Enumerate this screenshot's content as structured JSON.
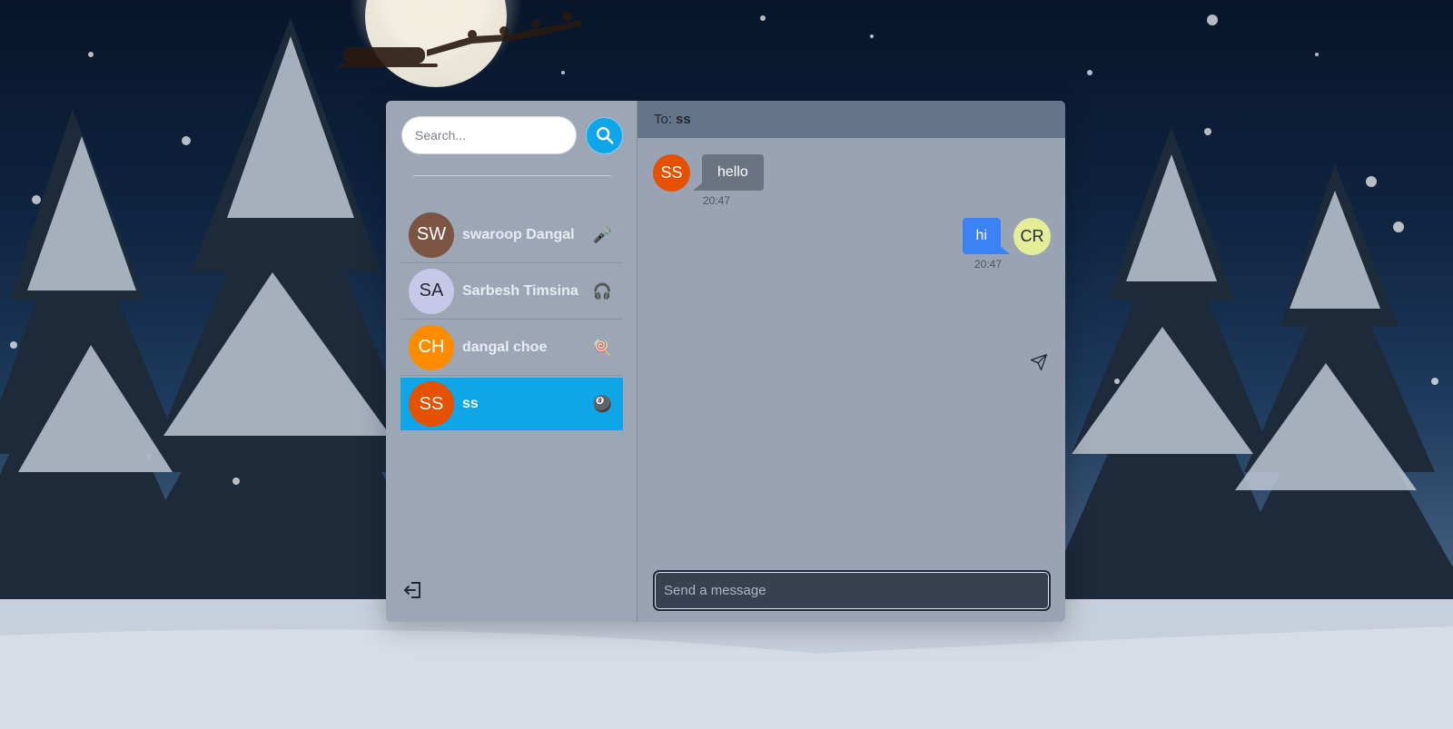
{
  "search": {
    "placeholder": "Search..."
  },
  "conversations": [
    {
      "initials": "SW",
      "name": "swaroop Dangal",
      "emoji": "🎤",
      "avatar_color": "#7c5443"
    },
    {
      "initials": "SA",
      "name": "Sarbesh Timsina",
      "emoji": "🎧",
      "avatar_color": "#c7c8e8",
      "initials_color": "#1f2937"
    },
    {
      "initials": "CH",
      "name": "dangal choe",
      "emoji": "🍭",
      "avatar_color": "#fb8c00"
    },
    {
      "initials": "SS",
      "name": "ss",
      "emoji": "🎱",
      "avatar_color": "#e65100",
      "active": true
    }
  ],
  "chat": {
    "to_label": "To:",
    "to_name": "ss",
    "messages": [
      {
        "direction": "incoming",
        "initials": "SS",
        "avatar_color": "#e65100",
        "text": "hello",
        "time": "20:47"
      },
      {
        "direction": "outgoing",
        "initials": "CR",
        "avatar_color": "#e3ee96",
        "text": "hi",
        "time": "20:47"
      }
    ],
    "composer_placeholder": "Send a message"
  },
  "colors": {
    "accent": "#0ea5e9",
    "outgoing_bubble": "#3b82f6",
    "incoming_bubble": "#6b7280"
  }
}
